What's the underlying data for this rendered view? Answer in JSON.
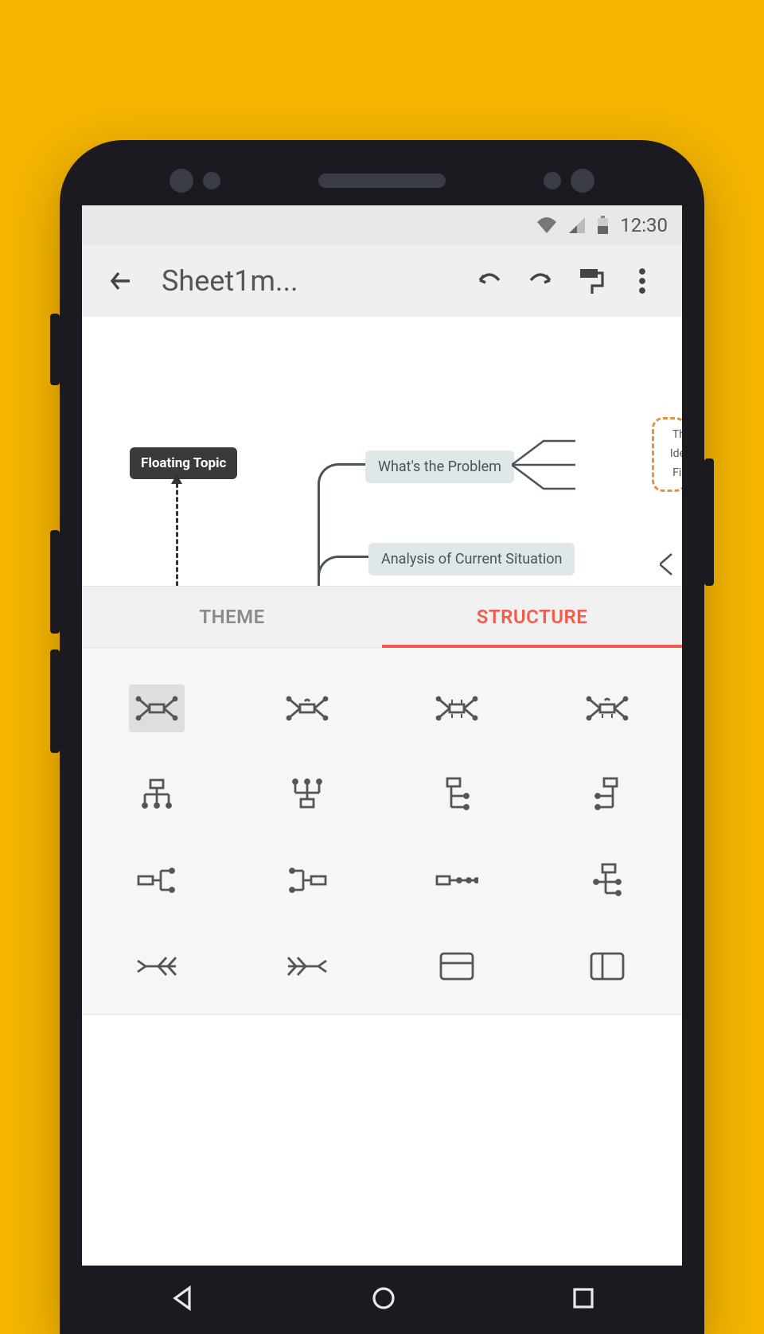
{
  "statusbar": {
    "time": "12:30"
  },
  "toolbar": {
    "title": "Sheet1m..."
  },
  "canvas": {
    "floating_topic": "Floating Topic",
    "node1": "What's the Problem",
    "node2": "Analysis of Current Situation",
    "chip1": "Th",
    "chip2": "Ide",
    "chip3": "Fir"
  },
  "tabs": {
    "theme": "THEME",
    "structure": "STRUCTURE",
    "active": "structure"
  },
  "structures": [
    {
      "id": "mindmap-balanced",
      "selected": true
    },
    {
      "id": "mindmap-clockwise",
      "selected": false
    },
    {
      "id": "mindmap-balanced-num",
      "selected": false
    },
    {
      "id": "mindmap-clockwise-num",
      "selected": false
    },
    {
      "id": "org-chart-down",
      "selected": false
    },
    {
      "id": "org-chart-up",
      "selected": false
    },
    {
      "id": "tree-right",
      "selected": false
    },
    {
      "id": "tree-left",
      "selected": false
    },
    {
      "id": "logic-right",
      "selected": false
    },
    {
      "id": "logic-left",
      "selected": false
    },
    {
      "id": "timeline-horizontal",
      "selected": false
    },
    {
      "id": "tree-table",
      "selected": false
    },
    {
      "id": "fishbone-left",
      "selected": false
    },
    {
      "id": "fishbone-right",
      "selected": false
    },
    {
      "id": "matrix-row",
      "selected": false
    },
    {
      "id": "matrix-column",
      "selected": false
    }
  ]
}
